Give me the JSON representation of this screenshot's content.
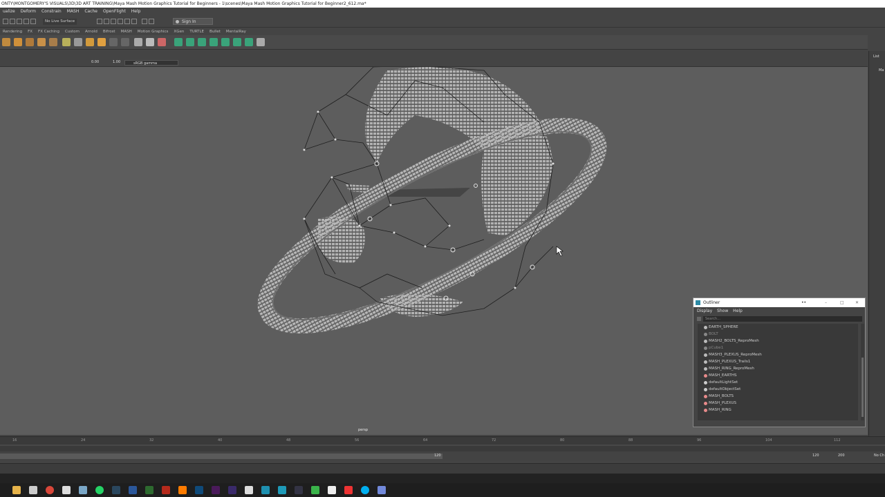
{
  "window": {
    "title": "ONTY\\MONTGOMERY'S VISUALS\\3D\\3D ART TRAINING\\Maya Mash Motion Graphics Tutorial for Beginners - 1\\scenes\\Maya Mash Motion Graphics Tutorial for Beginner2_612.ma*"
  },
  "menu": [
    "ualize",
    "Deform",
    "Constrain",
    "MASH",
    "Cache",
    "OpenFlight",
    "Help"
  ],
  "statusline": {
    "live_surface": "No Live Surface",
    "sign_in": "Sign In"
  },
  "shelf_tabs": [
    "Rendering",
    "FX",
    "FX Caching",
    "Custom",
    "Arnold",
    "Bifrost",
    "MASH",
    "Motion Graphics",
    "XGen",
    "TURTLE",
    "Bullet",
    "MentalRay"
  ],
  "right_panel": {
    "label_list": "List",
    "label_ma": "Ma"
  },
  "viewport": {
    "exposure": "0.00",
    "gamma": "1.00",
    "color_space": "sRGB gamma",
    "camera_label": "persp"
  },
  "timeline": {
    "ticks": [
      "16",
      "24",
      "32",
      "40",
      "48",
      "56",
      "64",
      "72",
      "80",
      "88",
      "96",
      "104",
      "112"
    ],
    "range_current": "120",
    "range_end": "120",
    "anim_end": "200",
    "no_character": "No Ch"
  },
  "outliner": {
    "title": "Outliner",
    "menu": [
      "Display",
      "Show",
      "Help"
    ],
    "search_placeholder": "Search...",
    "items": [
      {
        "label": "EARTH_SPHERE",
        "dim": false,
        "icon": "transform",
        "color": "#bbbbbb"
      },
      {
        "label": "BOLT",
        "dim": true,
        "icon": "transform",
        "color": "#888888"
      },
      {
        "label": "MASH2_BOLTS_ReproMesh",
        "dim": false,
        "icon": "transform",
        "color": "#bbbbbb"
      },
      {
        "label": "pCube1",
        "dim": true,
        "icon": "transform",
        "color": "#888888"
      },
      {
        "label": "MASH3_PLEXUS_ReproMesh",
        "dim": false,
        "icon": "transform",
        "color": "#bbbbbb"
      },
      {
        "label": "MASH_PLEXUS_Trails1",
        "dim": false,
        "icon": "transform",
        "color": "#bbbbbb"
      },
      {
        "label": "MASH_RING_ReproMesh",
        "dim": false,
        "icon": "transform",
        "color": "#bbbbbb"
      },
      {
        "label": "MASH_EARTHS",
        "dim": false,
        "icon": "set",
        "color": "#e88b8b"
      },
      {
        "label": "defaultLightSet",
        "dim": false,
        "icon": "lightset",
        "color": "#cccccc"
      },
      {
        "label": "defaultObjectSet",
        "dim": false,
        "icon": "lightset",
        "color": "#cccccc"
      },
      {
        "label": "MASH_BOLTS",
        "dim": false,
        "icon": "set",
        "color": "#e88b8b"
      },
      {
        "label": "MASH_PLEXUS",
        "dim": false,
        "icon": "set",
        "color": "#e88b8b"
      },
      {
        "label": "MASH_RING",
        "dim": false,
        "icon": "set",
        "color": "#e88b8b"
      }
    ]
  }
}
